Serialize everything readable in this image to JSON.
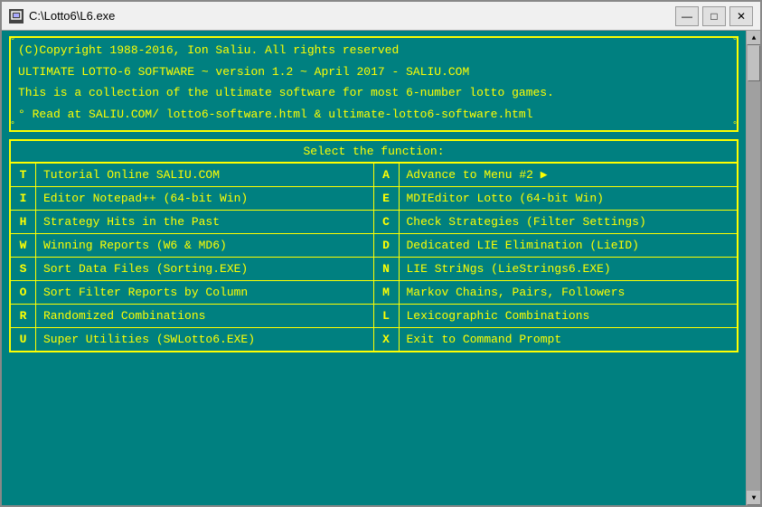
{
  "window": {
    "title": "C:\\Lotto6\\L6.exe",
    "minimize_label": "—",
    "maximize_label": "□",
    "close_label": "✕"
  },
  "info": {
    "line1": "(C)Copyright 1988-2016, Ion Saliu. All rights reserved",
    "line2": "ULTIMATE LOTTO-6 SOFTWARE ~ version 1.2 ~ April 2017 - SALIU.COM",
    "line3": "This is a collection of the ultimate software for most 6-number lotto games.",
    "line4": "° Read at SALIU.COM/ lotto6-software.html & ultimate-lotto6-software.html"
  },
  "menu": {
    "title": "Select the function:",
    "items": [
      {
        "key": "T",
        "label": "Tutorial Online SALIU.COM",
        "key2": "A",
        "label2": "Advance to Menu #2 ▶"
      },
      {
        "key": "I",
        "label": "Editor Notepad++ (64-bit Win)",
        "key2": "E",
        "label2": "MDIEditor Lotto (64-bit Win)"
      },
      {
        "key": "H",
        "label": "Strategy Hits in the Past",
        "key2": "C",
        "label2": "Check Strategies (Filter Settings)"
      },
      {
        "key": "W",
        "label": "Winning Reports (W6 & MD6)",
        "key2": "D",
        "label2": "Dedicated LIE Elimination (LieID)"
      },
      {
        "key": "S",
        "label": "Sort Data Files (Sorting.EXE)",
        "key2": "N",
        "label2": "LIE StriNgs (LieStrings6.EXE)"
      },
      {
        "key": "O",
        "label": "Sort Filter Reports by Column",
        "key2": "M",
        "label2": "Markov Chains, Pairs, Followers"
      },
      {
        "key": "R",
        "label": "Randomized Combinations",
        "key2": "L",
        "label2": "Lexicographic Combinations"
      },
      {
        "key": "U",
        "label": "Super Utilities (SWLotto6.EXE)",
        "key2": "X",
        "label2": "Exit to Command Prompt"
      }
    ]
  }
}
